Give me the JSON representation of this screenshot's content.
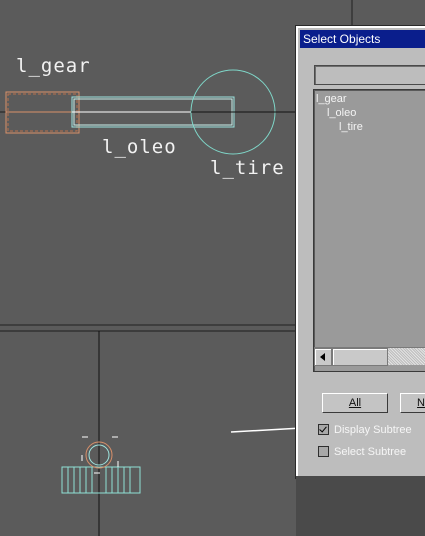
{
  "viewport": {
    "labels": {
      "gear": "l_gear",
      "oleo": "l_oleo",
      "tire": "l_tire"
    },
    "colors": {
      "background": "#5b5b5b",
      "gear_wire": "#d9906a",
      "oleo_wire": "#9ee6e0",
      "tire_wire": "#7fd6c8",
      "annotation_arrow": "#ffffff"
    }
  },
  "dialog": {
    "title": "Select Objects",
    "filter_value": "",
    "tree": [
      {
        "label": "l_gear",
        "depth": 0
      },
      {
        "label": "l_oleo",
        "depth": 1
      },
      {
        "label": "l_tire",
        "depth": 2
      }
    ],
    "buttons": {
      "all": "All",
      "none": "N"
    },
    "options": {
      "display_subtree": {
        "label": "Display Subtree",
        "checked": true
      },
      "select_subtree": {
        "label": "Select Subtree",
        "checked": false
      }
    },
    "colors": {
      "title_bar": "#0a1e8c",
      "body": "#bdbdbd",
      "list": "#9a9a9a"
    }
  }
}
